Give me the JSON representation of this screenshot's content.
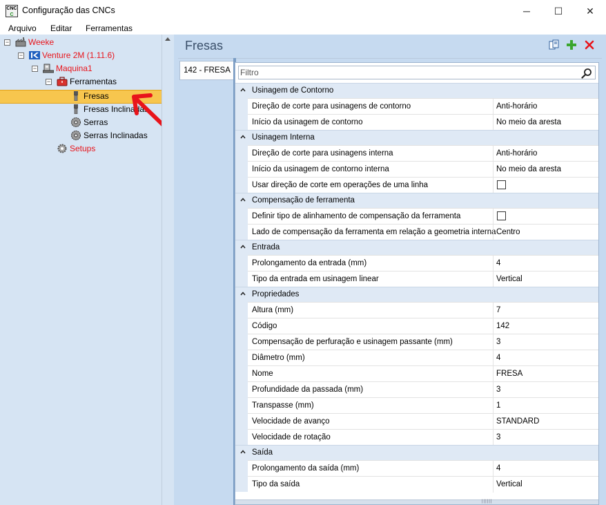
{
  "window": {
    "title": "Configuração das CNCs",
    "icon_text_top": "CNC",
    "icon_text_bottom": "C",
    "minimize_label": "─",
    "maximize_label": "☐",
    "close_label": "✕"
  },
  "menu": [
    {
      "label": "Arquivo"
    },
    {
      "label": "Editar"
    },
    {
      "label": "Ferramentas"
    }
  ],
  "tree": {
    "weeke": "Weeke",
    "venture": "Venture 2M (1.11.6)",
    "maquina": "Maquina1",
    "ferramentas": "Ferramentas",
    "fresas": "Fresas",
    "fresas_inclinadas": "Fresas Inclinadas",
    "serras": "Serras",
    "serras_inclinadas": "Serras Inclinadas",
    "setups": "Setups",
    "collapse_glyph": "−"
  },
  "panel": {
    "title": "Fresas",
    "tab_label": "142 - FRESA",
    "filter_placeholder": "Filtro",
    "grip": "||||||"
  },
  "colors": {
    "accent": "#e8141b",
    "selection": "#f7c64e",
    "panel_bg": "#c6daf0",
    "tree_bg": "#d6e4f3"
  },
  "icons": {
    "copy": "copy-icon",
    "add": "add-icon",
    "delete": "delete-icon",
    "search": "search-icon"
  },
  "categories": [
    {
      "title": "Usinagem de Contorno",
      "rows": [
        {
          "name": "Direção de corte para usinagens de contorno",
          "value": "Anti-horário"
        },
        {
          "name": "Início da usinagem de contorno",
          "value": "No meio da aresta"
        }
      ]
    },
    {
      "title": "Usinagem Interna",
      "rows": [
        {
          "name": "Direção de corte para usinagens interna",
          "value": "Anti-horário"
        },
        {
          "name": "Início da usinagem de contorno interna",
          "value": "No meio da aresta"
        },
        {
          "name": "Usar direção de corte em operações de uma linha",
          "checked": false
        }
      ]
    },
    {
      "title": "Compensação de ferramenta",
      "rows": [
        {
          "name": "Definir tipo de alinhamento de compensação da ferramenta",
          "checked": false
        },
        {
          "name": "Lado de compensação da ferramenta em relação a geometria interna",
          "value": "Centro"
        }
      ]
    },
    {
      "title": "Entrada",
      "rows": [
        {
          "name": "Prolongamento da entrada (mm)",
          "value": "4"
        },
        {
          "name": "Tipo da entrada em usinagem linear",
          "value": "Vertical"
        }
      ]
    },
    {
      "title": "Propriedades",
      "rows": [
        {
          "name": "Altura (mm)",
          "value": "7"
        },
        {
          "name": "Código",
          "value": "142"
        },
        {
          "name": "Compensação de perfuração e usinagem passante (mm)",
          "value": "3"
        },
        {
          "name": "Diâmetro (mm)",
          "value": "4"
        },
        {
          "name": "Nome",
          "value": "FRESA"
        },
        {
          "name": "Profundidade da passada (mm)",
          "value": "3"
        },
        {
          "name": "Transpasse (mm)",
          "value": "1"
        },
        {
          "name": "Velocidade de avanço",
          "value": "STANDARD"
        },
        {
          "name": "Velocidade de rotação",
          "value": "3"
        }
      ]
    },
    {
      "title": "Saída",
      "rows": [
        {
          "name": "Prolongamento da saída (mm)",
          "value": "4"
        },
        {
          "name": "Tipo da saída",
          "value": "Vertical"
        }
      ]
    }
  ]
}
